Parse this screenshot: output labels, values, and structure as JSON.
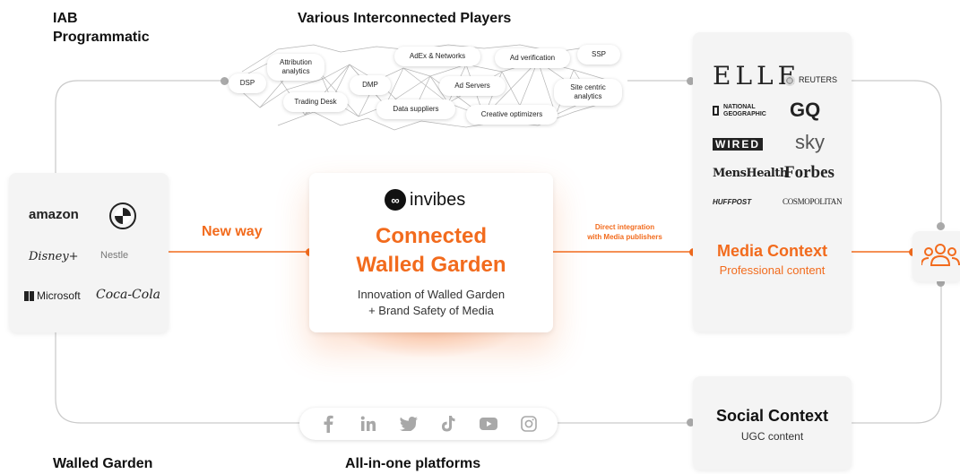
{
  "headings": {
    "iab": "IAB\nProgrammatic",
    "players": "Various Interconnected Players",
    "walled_garden": "Walled Garden",
    "all_in_one": "All-in-one platforms"
  },
  "players": [
    {
      "label": "DSP"
    },
    {
      "label": "Attribution\nanalytics"
    },
    {
      "label": "Trading Desk"
    },
    {
      "label": "DMP"
    },
    {
      "label": "AdEx & Networks"
    },
    {
      "label": "Ad Servers"
    },
    {
      "label": "Data suppliers"
    },
    {
      "label": "Ad verification"
    },
    {
      "label": "Creative optimizers"
    },
    {
      "label": "SSP"
    },
    {
      "label": "Site centric\nanalytics"
    }
  ],
  "advertisers": {
    "amazon": "amazon",
    "disney": "Disney+",
    "nestle": "Nestle",
    "microsoft": "Microsoft",
    "cocacola": "Coca-Cola"
  },
  "new_way": "New way",
  "center": {
    "logo_text": "invibes",
    "title_line1": "Connected",
    "title_line2": "Walled Garden",
    "subtitle_line1": "Innovation of Walled Garden",
    "subtitle_line2": "+ Brand Safety of Media"
  },
  "direct_integration": {
    "line1": "Direct integration",
    "line2": "with Media publishers"
  },
  "publishers": {
    "elle": "ELLE",
    "reuters": "REUTERS",
    "natgeo_line1": "NATIONAL",
    "natgeo_line2": "GEOGRAPHIC",
    "gq": "GQ",
    "wired": "WIRED",
    "sky": "sky",
    "menshealth": "MensHealth",
    "forbes": "Forbes",
    "huffpost": "HUFFPOST",
    "cosmopolitan": "COSMOPOLITAN"
  },
  "media_context": {
    "title": "Media Context",
    "subtitle": "Professional content"
  },
  "social_context": {
    "title": "Social Context",
    "subtitle": "UGC content"
  },
  "social_icons": [
    "facebook-icon",
    "linkedin-icon",
    "twitter-icon",
    "tiktok-icon",
    "youtube-icon",
    "instagram-icon"
  ],
  "colors": {
    "accent": "#f26b1d",
    "line_grey": "#bdbdbd",
    "card_bg": "#f4f4f4"
  }
}
